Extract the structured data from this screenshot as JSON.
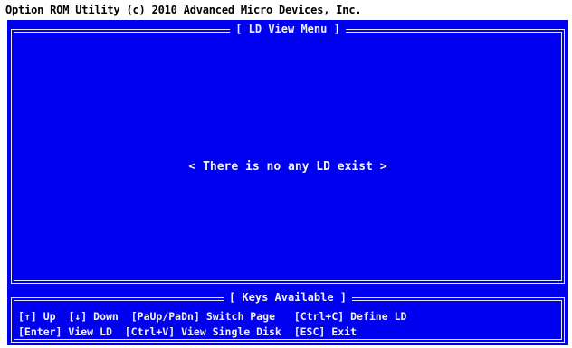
{
  "app": {
    "title": "Option ROM Utility (c) 2010 Advanced Micro Devices, Inc."
  },
  "ld_view_menu": {
    "title": "[ LD View Menu ]",
    "message": "< There is no any LD exist >"
  },
  "keys_available": {
    "title": "[ Keys Available ]",
    "row1": [
      {
        "key": "[↑]",
        "action": "Up"
      },
      {
        "key": "[↓]",
        "action": "Down"
      },
      {
        "key": "[PaUp/PaDn]",
        "action": "Switch Page"
      },
      {
        "key": "[Ctrl+C]",
        "action": "Define LD"
      }
    ],
    "row2": [
      {
        "key": "[Enter]",
        "action": "View LD"
      },
      {
        "key": "[Ctrl+V]",
        "action": "View Single Disk"
      },
      {
        "key": "[ESC]",
        "action": "Exit"
      }
    ]
  },
  "colors": {
    "panel_background": "#0000f0",
    "text_foreground": "#f2f2f2",
    "page_background": "#ffffff"
  }
}
